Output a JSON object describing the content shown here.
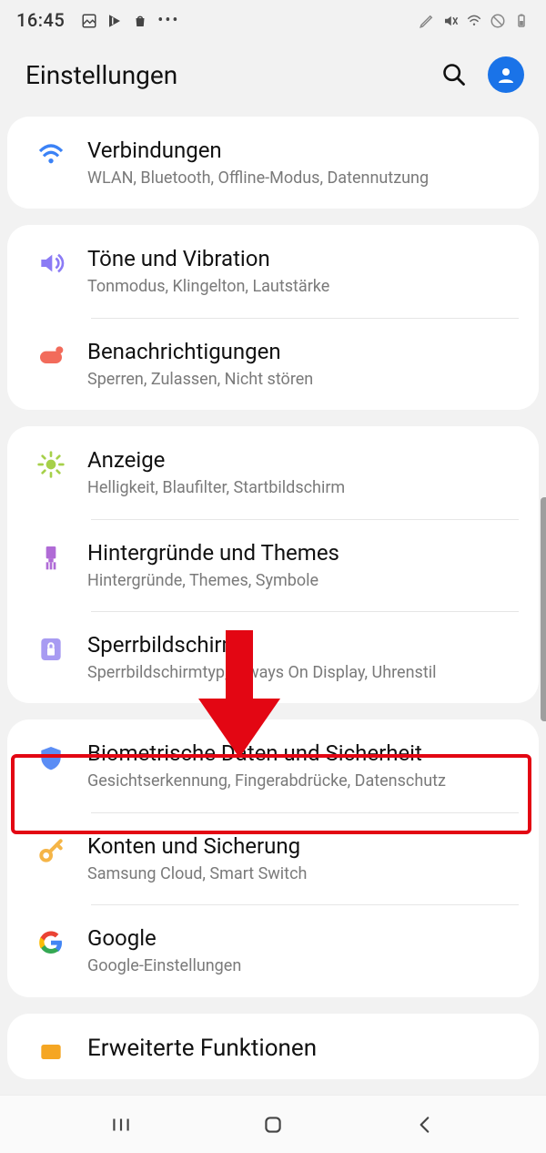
{
  "status": {
    "time": "16:45"
  },
  "header": {
    "title": "Einstellungen"
  },
  "groups": [
    {
      "items": [
        {
          "title": "Verbindungen",
          "sub": "WLAN, Bluetooth, Offline-Modus, Datennutzung"
        }
      ]
    },
    {
      "items": [
        {
          "title": "Töne und Vibration",
          "sub": "Tonmodus, Klingelton, Lautstärke"
        },
        {
          "title": "Benachrichtigungen",
          "sub": "Sperren, Zulassen, Nicht stören"
        }
      ]
    },
    {
      "items": [
        {
          "title": "Anzeige",
          "sub": "Helligkeit, Blaufilter, Startbildschirm"
        },
        {
          "title": "Hintergründe und Themes",
          "sub": "Hintergründe, Themes, Symbole"
        },
        {
          "title": "Sperrbildschirm",
          "sub": "Sperrbildschirmtyp, Always On Display, Uhrenstil"
        }
      ]
    },
    {
      "items": [
        {
          "title": "Biometrische Daten und Sicherheit",
          "sub": "Gesichtserkennung, Fingerabdrücke, Datenschutz"
        },
        {
          "title": "Konten und Sicherung",
          "sub": "Samsung Cloud, Smart Switch"
        },
        {
          "title": "Google",
          "sub": "Google-Einstellungen"
        }
      ]
    },
    {
      "items": [
        {
          "title": "Erweiterte Funktionen",
          "sub": ""
        }
      ]
    }
  ]
}
